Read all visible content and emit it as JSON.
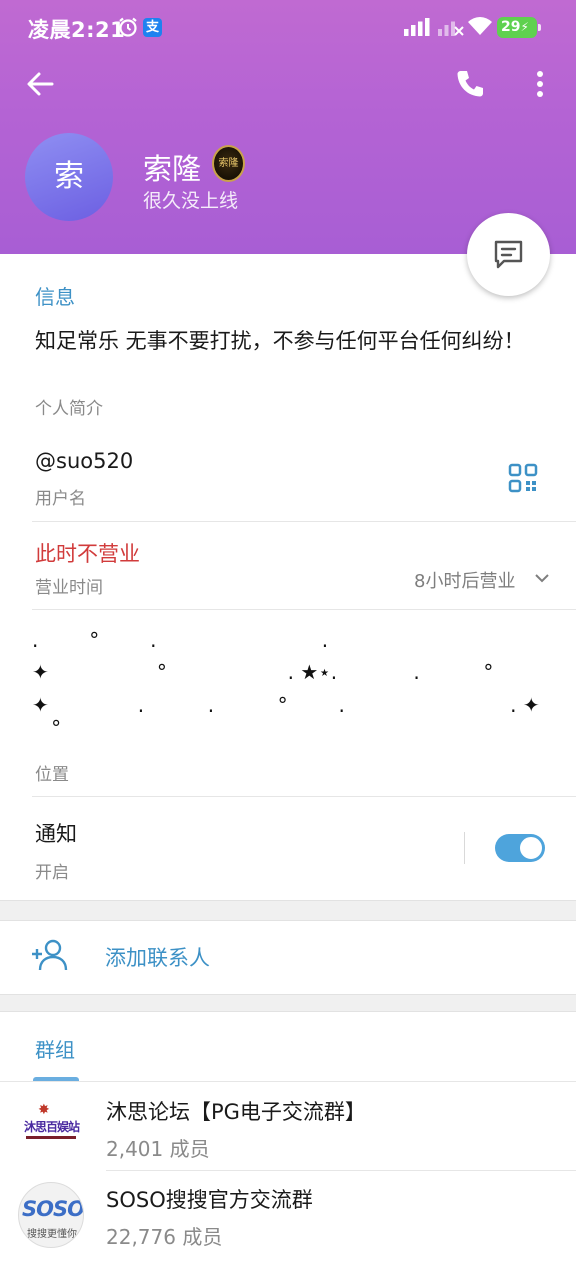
{
  "status_bar": {
    "time": "凌晨2:21",
    "pay_badge": "支",
    "battery": "29"
  },
  "header": {
    "avatar_char": "索",
    "name": "索隆",
    "badge_text": "索隆",
    "status": "很久没上线"
  },
  "info": {
    "section_title": "信息",
    "bio": "知足常乐 无事不要打扰，不参与任何平台任何纠纷！",
    "bio_label": "个人简介",
    "username": "@suo520",
    "username_label": "用户名",
    "business_status": "此时不营业",
    "business_label": "营业时间",
    "business_hours": "8小时后营业",
    "location_lines": [
      ".        °        .                          .",
      "✦                 °                   . ★⋆.            .          °",
      "✦              .          .          °        .                          . ✦",
      "   °"
    ],
    "location_label": "位置",
    "notify_title": "通知",
    "notify_state": "开启",
    "notify_on": true
  },
  "actions": {
    "add_contact": "添加联系人"
  },
  "groups": {
    "section_title": "群组",
    "items": [
      {
        "name": "沐思论坛【PG电子交流群】",
        "members": "2,401 成员",
        "avatar_text": "沐思百娱站"
      },
      {
        "name": "SOSO搜搜官方交流群",
        "members": "22,776 成员",
        "avatar_text": "SOSO",
        "avatar_sub": "搜搜更懂你"
      }
    ]
  },
  "colors": {
    "header_gradient": [
      "#c06ad2",
      "#a85ed4"
    ],
    "accent": "#3d91c6",
    "closed_red": "#d13b3b",
    "toggle": "#4ea4dc"
  },
  "icons": [
    "back-arrow-icon",
    "phone-icon",
    "more-vertical-icon",
    "message-icon",
    "qr-code-icon",
    "chevron-down-icon",
    "add-contact-icon",
    "alarm-icon",
    "signal-icon",
    "wifi-icon",
    "battery-icon"
  ]
}
